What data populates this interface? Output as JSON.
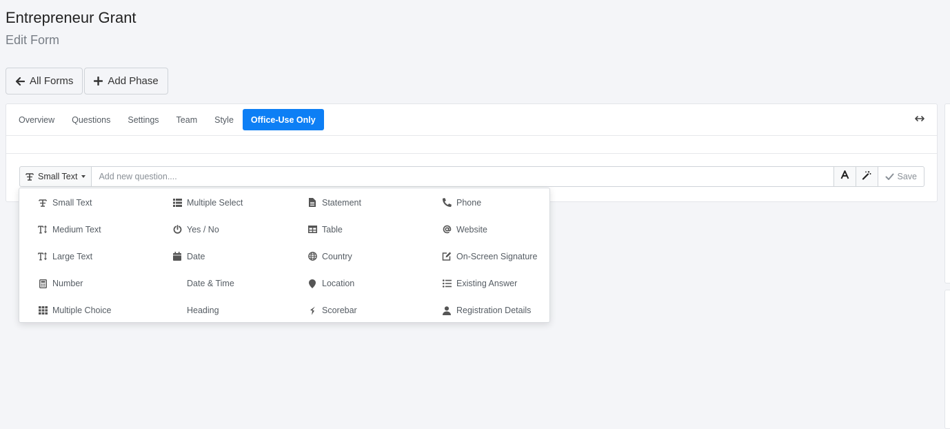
{
  "header": {
    "title": "Entrepreneur Grant",
    "subtitle": "Edit Form"
  },
  "actions": {
    "all_forms": "All Forms",
    "add_phase": "Add Phase"
  },
  "tabs": [
    {
      "label": "Overview"
    },
    {
      "label": "Questions"
    },
    {
      "label": "Settings"
    },
    {
      "label": "Team"
    },
    {
      "label": "Style"
    },
    {
      "label": "Office-Use Only",
      "active": true
    }
  ],
  "question_bar": {
    "type_label": "Small Text",
    "placeholder": "Add new question....",
    "save_label": "Save"
  },
  "menu": {
    "items": [
      {
        "label": "Small Text",
        "icon": "small-text-icon"
      },
      {
        "label": "Multiple Select",
        "icon": "list-icon"
      },
      {
        "label": "Statement",
        "icon": "file-icon"
      },
      {
        "label": "Phone",
        "icon": "phone-icon"
      },
      {
        "label": "Medium Text",
        "icon": "text-height-icon"
      },
      {
        "label": "Yes / No",
        "icon": "power-icon"
      },
      {
        "label": "Table",
        "icon": "table-icon"
      },
      {
        "label": "Website",
        "icon": "at-icon"
      },
      {
        "label": "Large Text",
        "icon": "text-height-icon"
      },
      {
        "label": "Date",
        "icon": "calendar-icon"
      },
      {
        "label": "Country",
        "icon": "globe-icon"
      },
      {
        "label": "On-Screen Signature",
        "icon": "edit-icon"
      },
      {
        "label": "Number",
        "icon": "calculator-icon"
      },
      {
        "label": "Date & Time",
        "icon": ""
      },
      {
        "label": "Location",
        "icon": "map-marker-icon"
      },
      {
        "label": "Existing Answer",
        "icon": "list-ul-icon"
      },
      {
        "label": "Multiple Choice",
        "icon": "grid-icon"
      },
      {
        "label": "Heading",
        "icon": ""
      },
      {
        "label": "Scorebar",
        "icon": "scorebar-icon"
      },
      {
        "label": "Registration Details",
        "icon": "user-icon"
      }
    ]
  },
  "colors": {
    "accent": "#0d7ff5",
    "background": "#f4f5f8",
    "muted_text": "#555c63"
  }
}
